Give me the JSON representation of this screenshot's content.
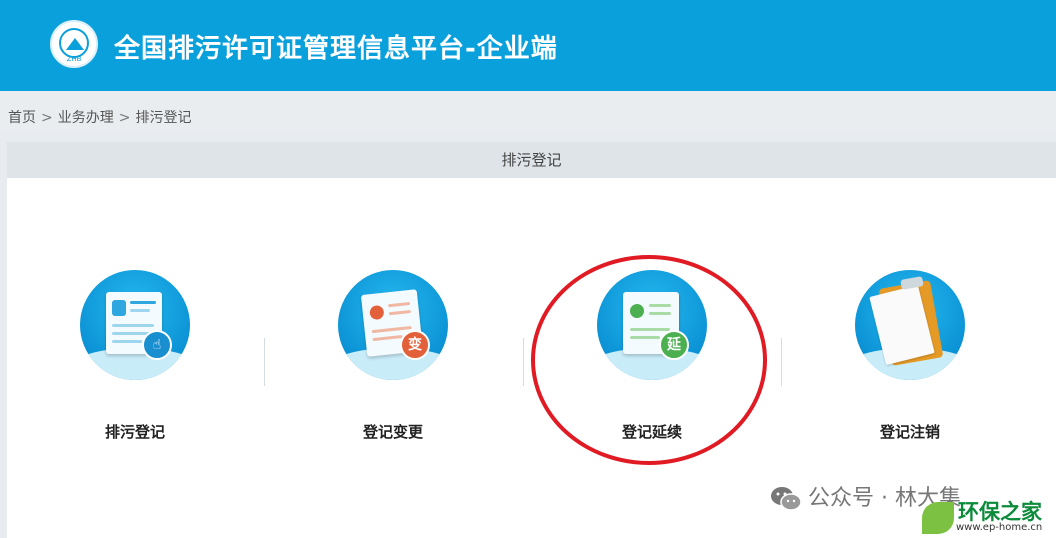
{
  "header": {
    "logo_text": "ZHB",
    "title": "全国排污许可证管理信息平台-企业端"
  },
  "breadcrumb": {
    "items": [
      "首页",
      "业务办理",
      "排污登记"
    ],
    "sep1": ">",
    "sep2": ">"
  },
  "panel": {
    "title": "排污登记"
  },
  "services": [
    {
      "label": "排污登记",
      "icon": "hand-card-icon"
    },
    {
      "label": "登记变更",
      "icon": "certificate-change-icon",
      "badge": "变"
    },
    {
      "label": "登记延续",
      "icon": "certificate-extend-icon",
      "badge": "延"
    },
    {
      "label": "登记注销",
      "icon": "clipboard-icon"
    }
  ],
  "colors": {
    "header_bg": "#0aa0db",
    "annotation_ring": "#e01b24",
    "change_badge": "#e2603a",
    "extend_badge": "#4caf50"
  },
  "watermark": {
    "wechat": "公众号 · 林大集",
    "site_name": "环保之家",
    "site_url": "www.ep-home.cn"
  }
}
